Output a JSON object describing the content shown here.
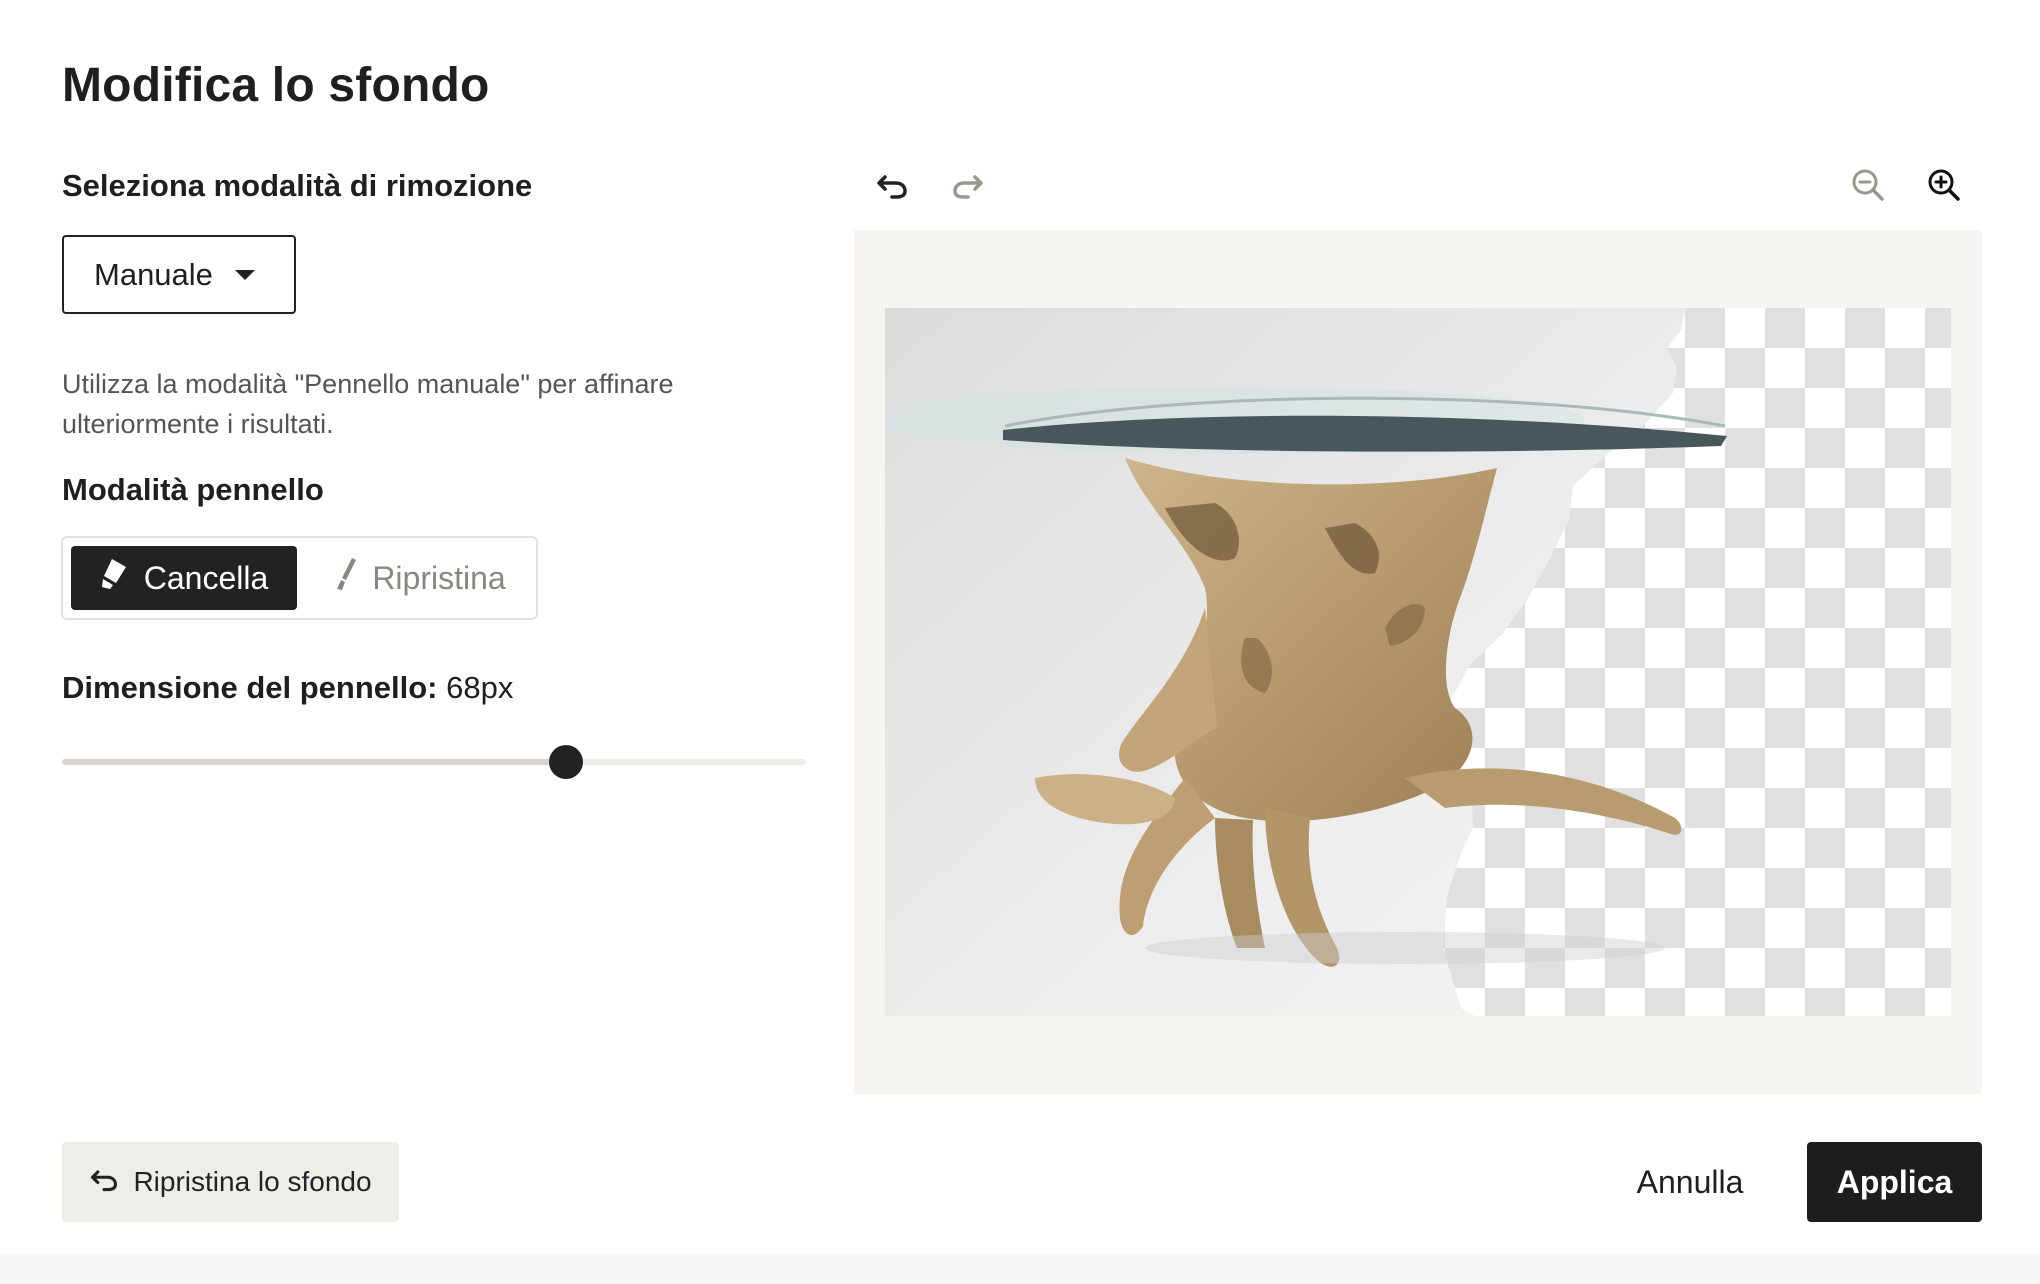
{
  "dialog": {
    "title": "Modifica lo sfondo"
  },
  "removal_mode": {
    "label": "Seleziona modalità di rimozione",
    "selected": "Manuale",
    "hint": "Utilizza la modalità \"Pennello manuale\" per affinare ulteriormente i risultati."
  },
  "brush_mode": {
    "label": "Modalità pennello",
    "erase_label": "Cancella",
    "restore_label": "Ripristina",
    "active": "Cancella"
  },
  "brush_size": {
    "label": "Dimensione del pennello:",
    "value_text": "68px",
    "fraction": 0.677
  },
  "toolbar": {
    "undo_icon": "undo-icon",
    "redo_icon": "redo-icon",
    "zoom_out_icon": "zoom-out-icon",
    "zoom_in_icon": "zoom-in-icon"
  },
  "footer": {
    "reset_background_label": "Ripristina lo sfondo",
    "cancel_label": "Annulla",
    "apply_label": "Applica"
  },
  "colors": {
    "primary": "#1d1d1d",
    "canvas_bg": "#f6f5f1",
    "secondary_button": "#efede8",
    "muted_text": "#8a8780"
  }
}
